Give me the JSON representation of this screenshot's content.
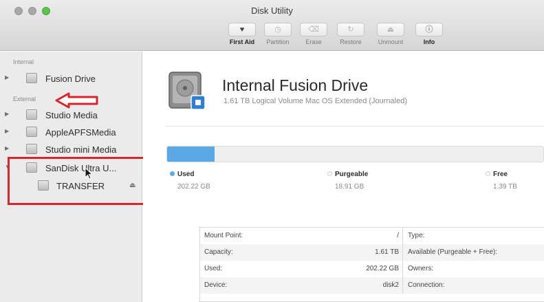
{
  "window": {
    "title": "Disk Utility"
  },
  "toolbar": [
    {
      "label": "First Aid",
      "glyph": "♥",
      "state": "active"
    },
    {
      "label": "Partition",
      "glyph": "◷",
      "state": "disabled"
    },
    {
      "label": "Erase",
      "glyph": "⌫",
      "state": "disabled"
    },
    {
      "label": "Restore",
      "glyph": "↻",
      "state": "disabled"
    },
    {
      "label": "Unmount",
      "glyph": "⏏",
      "state": "disabled"
    },
    {
      "label": "Info",
      "glyph": "ⓘ",
      "state": "active"
    }
  ],
  "sidebar": {
    "internal_header": "Internal",
    "external_header": "External",
    "internal_items": [
      {
        "label": "Fusion Drive",
        "expand": "▶"
      }
    ],
    "external_items": [
      {
        "label": "Studio Media",
        "expand": "▶"
      },
      {
        "label": "AppleAPFSMedia",
        "expand": "▶"
      },
      {
        "label": "Studio mini Media",
        "expand": "▶"
      },
      {
        "label": "SanDisk Ultra U...",
        "expand": "▼"
      }
    ],
    "child_items": [
      {
        "label": "TRANSFER",
        "eject": "⏏"
      }
    ]
  },
  "disk": {
    "name": "Internal Fusion Drive",
    "subtitle": "1.61 TB Logical Volume Mac OS Extended (Journaled)"
  },
  "usage": {
    "used_fraction": 0.1256,
    "colors": {
      "used": "#5aa8e6",
      "purgeable": "#ffffff",
      "free": "#ffffff"
    },
    "used": {
      "label": "Used",
      "value": "202.22 GB"
    },
    "purgeable": {
      "label": "Purgeable",
      "value": "18.91 GB"
    },
    "free": {
      "label": "Free",
      "value": "1.39 TB"
    }
  },
  "info": [
    {
      "key1": "Mount Point:",
      "val1": "/",
      "key2": "Type:"
    },
    {
      "key1": "Capacity:",
      "val1": "1.61 TB",
      "key2": "Available (Purgeable + Free):"
    },
    {
      "key1": "Used:",
      "val1": "202.22 GB",
      "key2": "Owners:"
    },
    {
      "key1": "Device:",
      "val1": "disk2",
      "key2": "Connection:"
    }
  ],
  "annotations": {
    "arrow_color": "#d9262b",
    "box_color": "#d9262b"
  }
}
